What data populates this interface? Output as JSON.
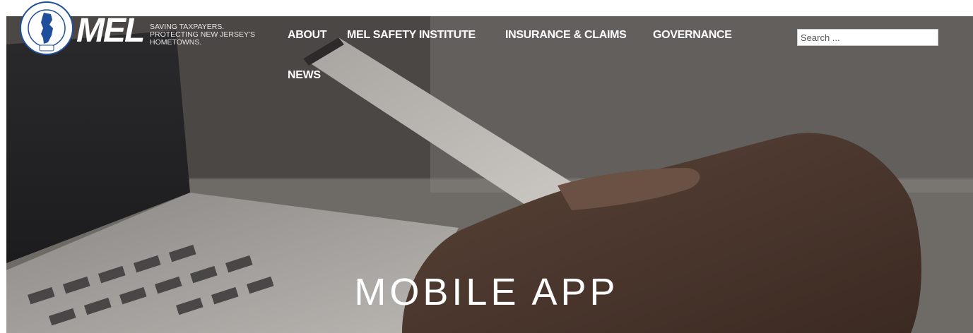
{
  "header": {
    "logo": {
      "ring_text": "MUNICIPAL EXCESS LIABILITY JOINT INSURANCE FUND",
      "badge": "MEL"
    },
    "wordmark": "MEL",
    "tagline": [
      "SAVING TAXPAYERS.",
      "PROTECTING NEW JERSEY'S",
      "HOMETOWNS."
    ]
  },
  "nav": {
    "items": [
      {
        "label": "ABOUT"
      },
      {
        "label": "MEL SAFETY INSTITUTE"
      },
      {
        "label": "INSURANCE & CLAIMS"
      },
      {
        "label": "GOVERNANCE"
      },
      {
        "label": "NEWS"
      }
    ]
  },
  "search": {
    "placeholder": "Search ..."
  },
  "hero": {
    "title": "MOBILE APP"
  },
  "colors": {
    "nav_text": "#ffffff",
    "logo_blue": "#1f4e9c",
    "hero_overlay": "#3c3835"
  }
}
